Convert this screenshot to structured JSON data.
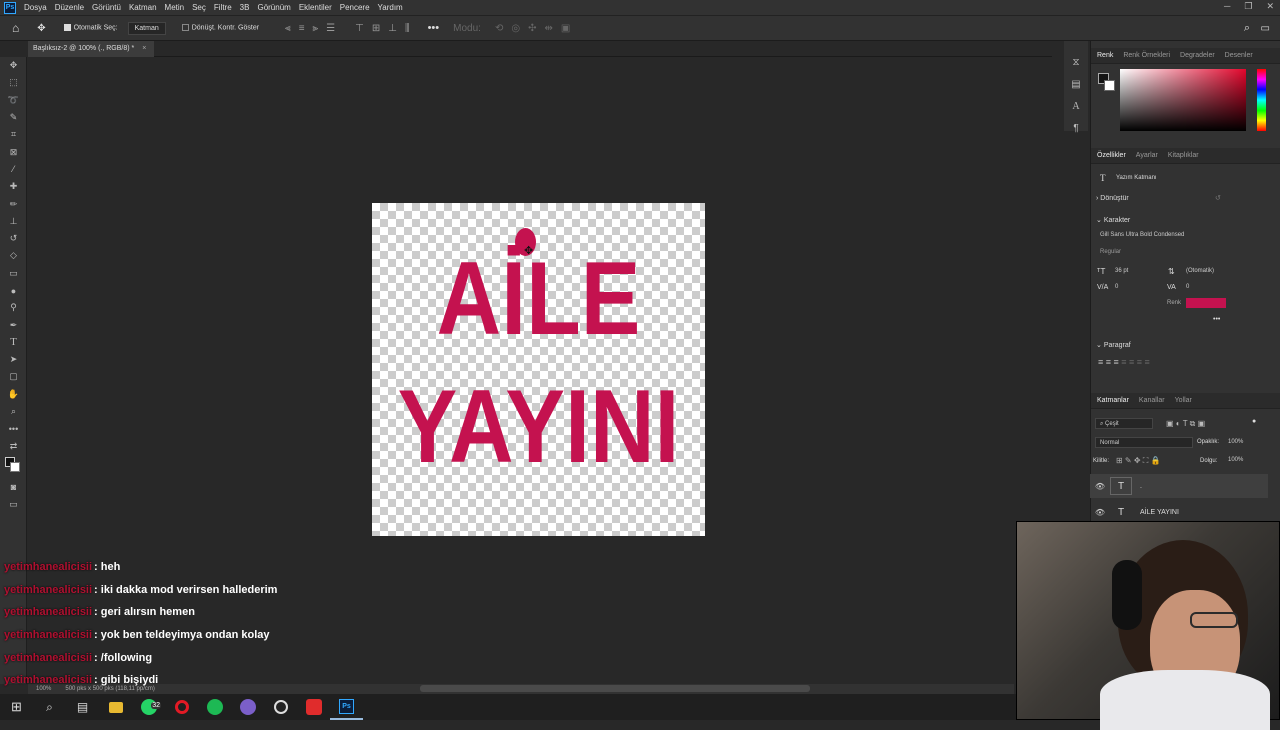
{
  "app": {
    "logo": "Ps"
  },
  "menu": [
    "Dosya",
    "Düzenle",
    "Görüntü",
    "Katman",
    "Metin",
    "Seç",
    "Filtre",
    "3B",
    "Görünüm",
    "Eklentiler",
    "Pencere",
    "Yardım"
  ],
  "options": {
    "auto_select_label": "Otomatik Seç:",
    "layer_select_value": "Katman",
    "transform_controls_label": "Dönüşt. Kontr. Göster",
    "mode_label": "Modu:"
  },
  "document_tab": "Başlıksız-2 @ 100% (., RGB/8) *",
  "canvas": {
    "line1": "AİLE",
    "line2": "YAYINI",
    "text_color": "#c4124f"
  },
  "panels": {
    "color_tabs": [
      "Renk",
      "Renk Örnekleri",
      "Degradeler",
      "Desenler"
    ],
    "properties_tabs": [
      "Özellikler",
      "Ayarlar",
      "Kitaplıklar"
    ],
    "type_layer_label": "Yazım Katmanı",
    "transform_section": "Dönüştür",
    "character_section": "Karakter",
    "font_family": "Gill Sans Ultra Bold Condensed",
    "font_style": "Regular",
    "font_size": "36 pt",
    "leading": "(Otomatik)",
    "kerning": "0",
    "tracking": "0",
    "color_label": "Renk",
    "color_value": "#c4124f",
    "more": "•••",
    "paragraph_section": "Paragraf",
    "layers_tabs": [
      "Katmanlar",
      "Kanallar",
      "Yollar"
    ],
    "filter_label": "Çeşit",
    "blend_mode": "Normal",
    "opacity_label": "Opaklık:",
    "opacity_value": "100%",
    "lock_label": "Kilitle:",
    "fill_label": "Dolgu:",
    "fill_value": "100%",
    "layers": [
      {
        "name": ".",
        "type": "T"
      },
      {
        "name": "AİLE YAYINI",
        "type": "T"
      }
    ]
  },
  "status": {
    "zoom": "100%",
    "doc_info": "500 pks x 500 pks (118,11 pp/cm)"
  },
  "chat": [
    {
      "nick": "yetimhanealicisii",
      "msg": ": heh"
    },
    {
      "nick": "yetimhanealicisii",
      "msg": ": iki dakka mod verirsen hallederim"
    },
    {
      "nick": "yetimhanealicisii",
      "msg": ": geri alırsın hemen"
    },
    {
      "nick": "yetimhanealicisii",
      "msg": ": yok ben teldeyimya ondan kolay"
    },
    {
      "nick": "yetimhanealicisii",
      "msg": ": /following"
    },
    {
      "nick": "yetimhanealicisii",
      "msg": ": gibi bişiydi"
    }
  ],
  "taskbar": {
    "whatsapp_badge": "32"
  }
}
